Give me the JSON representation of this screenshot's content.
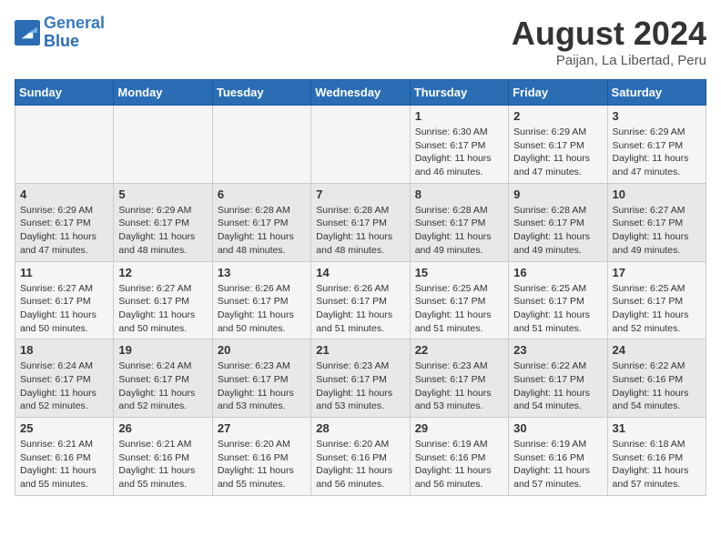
{
  "header": {
    "logo_line1": "General",
    "logo_line2": "Blue",
    "month_year": "August 2024",
    "location": "Paijan, La Libertad, Peru"
  },
  "weekdays": [
    "Sunday",
    "Monday",
    "Tuesday",
    "Wednesday",
    "Thursday",
    "Friday",
    "Saturday"
  ],
  "weeks": [
    [
      {
        "day": "",
        "info": ""
      },
      {
        "day": "",
        "info": ""
      },
      {
        "day": "",
        "info": ""
      },
      {
        "day": "",
        "info": ""
      },
      {
        "day": "1",
        "info": "Sunrise: 6:30 AM\nSunset: 6:17 PM\nDaylight: 11 hours\nand 46 minutes."
      },
      {
        "day": "2",
        "info": "Sunrise: 6:29 AM\nSunset: 6:17 PM\nDaylight: 11 hours\nand 47 minutes."
      },
      {
        "day": "3",
        "info": "Sunrise: 6:29 AM\nSunset: 6:17 PM\nDaylight: 11 hours\nand 47 minutes."
      }
    ],
    [
      {
        "day": "4",
        "info": "Sunrise: 6:29 AM\nSunset: 6:17 PM\nDaylight: 11 hours\nand 47 minutes."
      },
      {
        "day": "5",
        "info": "Sunrise: 6:29 AM\nSunset: 6:17 PM\nDaylight: 11 hours\nand 48 minutes."
      },
      {
        "day": "6",
        "info": "Sunrise: 6:28 AM\nSunset: 6:17 PM\nDaylight: 11 hours\nand 48 minutes."
      },
      {
        "day": "7",
        "info": "Sunrise: 6:28 AM\nSunset: 6:17 PM\nDaylight: 11 hours\nand 48 minutes."
      },
      {
        "day": "8",
        "info": "Sunrise: 6:28 AM\nSunset: 6:17 PM\nDaylight: 11 hours\nand 49 minutes."
      },
      {
        "day": "9",
        "info": "Sunrise: 6:28 AM\nSunset: 6:17 PM\nDaylight: 11 hours\nand 49 minutes."
      },
      {
        "day": "10",
        "info": "Sunrise: 6:27 AM\nSunset: 6:17 PM\nDaylight: 11 hours\nand 49 minutes."
      }
    ],
    [
      {
        "day": "11",
        "info": "Sunrise: 6:27 AM\nSunset: 6:17 PM\nDaylight: 11 hours\nand 50 minutes."
      },
      {
        "day": "12",
        "info": "Sunrise: 6:27 AM\nSunset: 6:17 PM\nDaylight: 11 hours\nand 50 minutes."
      },
      {
        "day": "13",
        "info": "Sunrise: 6:26 AM\nSunset: 6:17 PM\nDaylight: 11 hours\nand 50 minutes."
      },
      {
        "day": "14",
        "info": "Sunrise: 6:26 AM\nSunset: 6:17 PM\nDaylight: 11 hours\nand 51 minutes."
      },
      {
        "day": "15",
        "info": "Sunrise: 6:25 AM\nSunset: 6:17 PM\nDaylight: 11 hours\nand 51 minutes."
      },
      {
        "day": "16",
        "info": "Sunrise: 6:25 AM\nSunset: 6:17 PM\nDaylight: 11 hours\nand 51 minutes."
      },
      {
        "day": "17",
        "info": "Sunrise: 6:25 AM\nSunset: 6:17 PM\nDaylight: 11 hours\nand 52 minutes."
      }
    ],
    [
      {
        "day": "18",
        "info": "Sunrise: 6:24 AM\nSunset: 6:17 PM\nDaylight: 11 hours\nand 52 minutes."
      },
      {
        "day": "19",
        "info": "Sunrise: 6:24 AM\nSunset: 6:17 PM\nDaylight: 11 hours\nand 52 minutes."
      },
      {
        "day": "20",
        "info": "Sunrise: 6:23 AM\nSunset: 6:17 PM\nDaylight: 11 hours\nand 53 minutes."
      },
      {
        "day": "21",
        "info": "Sunrise: 6:23 AM\nSunset: 6:17 PM\nDaylight: 11 hours\nand 53 minutes."
      },
      {
        "day": "22",
        "info": "Sunrise: 6:23 AM\nSunset: 6:17 PM\nDaylight: 11 hours\nand 53 minutes."
      },
      {
        "day": "23",
        "info": "Sunrise: 6:22 AM\nSunset: 6:17 PM\nDaylight: 11 hours\nand 54 minutes."
      },
      {
        "day": "24",
        "info": "Sunrise: 6:22 AM\nSunset: 6:16 PM\nDaylight: 11 hours\nand 54 minutes."
      }
    ],
    [
      {
        "day": "25",
        "info": "Sunrise: 6:21 AM\nSunset: 6:16 PM\nDaylight: 11 hours\nand 55 minutes."
      },
      {
        "day": "26",
        "info": "Sunrise: 6:21 AM\nSunset: 6:16 PM\nDaylight: 11 hours\nand 55 minutes."
      },
      {
        "day": "27",
        "info": "Sunrise: 6:20 AM\nSunset: 6:16 PM\nDaylight: 11 hours\nand 55 minutes."
      },
      {
        "day": "28",
        "info": "Sunrise: 6:20 AM\nSunset: 6:16 PM\nDaylight: 11 hours\nand 56 minutes."
      },
      {
        "day": "29",
        "info": "Sunrise: 6:19 AM\nSunset: 6:16 PM\nDaylight: 11 hours\nand 56 minutes."
      },
      {
        "day": "30",
        "info": "Sunrise: 6:19 AM\nSunset: 6:16 PM\nDaylight: 11 hours\nand 57 minutes."
      },
      {
        "day": "31",
        "info": "Sunrise: 6:18 AM\nSunset: 6:16 PM\nDaylight: 11 hours\nand 57 minutes."
      }
    ]
  ]
}
